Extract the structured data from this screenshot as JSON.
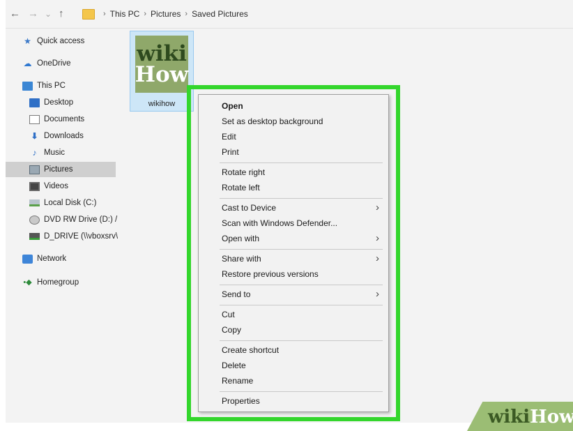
{
  "address_bar": {
    "back": "←",
    "forward": "→",
    "recent": "⌄",
    "up": "↑",
    "path_sep": "›",
    "path": [
      "This PC",
      "Pictures",
      "Saved Pictures"
    ]
  },
  "nav": {
    "quick_access": "Quick access",
    "onedrive": "OneDrive",
    "this_pc": "This PC",
    "desktop": "Desktop",
    "documents": "Documents",
    "downloads": "Downloads",
    "music": "Music",
    "pictures": "Pictures",
    "videos": "Videos",
    "local_disk": "Local Disk (C:)",
    "dvd": "DVD RW Drive (D:) /",
    "d_drive": "D_DRIVE (\\\\vboxsrv\\",
    "network": "Network",
    "homegroup": "Homegroup"
  },
  "file": {
    "name": "wikihow",
    "thumb_line1": "wiki",
    "thumb_line2": "How"
  },
  "menu": {
    "open": "Open",
    "set_bg": "Set as desktop background",
    "edit": "Edit",
    "print": "Print",
    "rotate_right": "Rotate right",
    "rotate_left": "Rotate left",
    "cast": "Cast to Device",
    "scan": "Scan with Windows Defender...",
    "open_with": "Open with",
    "share_with": "Share with",
    "restore": "Restore previous versions",
    "send_to": "Send to",
    "cut": "Cut",
    "copy": "Copy",
    "create_shortcut": "Create shortcut",
    "delete": "Delete",
    "rename": "Rename",
    "properties": "Properties",
    "submenu_arrow": "›"
  },
  "watermark": {
    "part1": "wiki",
    "part2": "How"
  },
  "colors": {
    "highlight": "#33d62c",
    "selection": "#cde6f7",
    "nav_selected": "#cfcfcf"
  }
}
